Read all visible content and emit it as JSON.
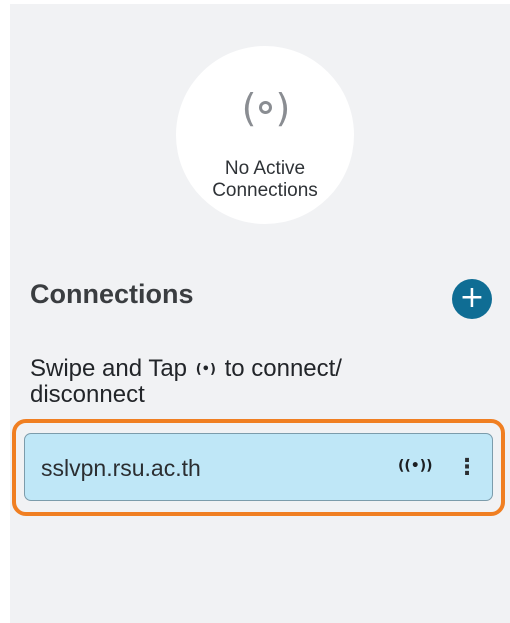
{
  "status": {
    "icon": "broadcast-icon",
    "line1": "No Active",
    "line2": "Connections"
  },
  "connections": {
    "title": "Connections",
    "add_icon": "plus-icon",
    "add_glyph": "+",
    "hint_before": "Swipe and Tap",
    "hint_icon": "broadcast-icon",
    "hint_after": "to connect/ disconnect",
    "items": [
      {
        "name": "sslvpn.rsu.ac.th",
        "connect_icon": "broadcast-icon",
        "menu_icon": "more-vertical-icon"
      }
    ]
  },
  "colors": {
    "accent": "#0f6d94",
    "highlight": "#f07f22",
    "card": "#bfe7f7",
    "background": "#f1f2f4"
  }
}
